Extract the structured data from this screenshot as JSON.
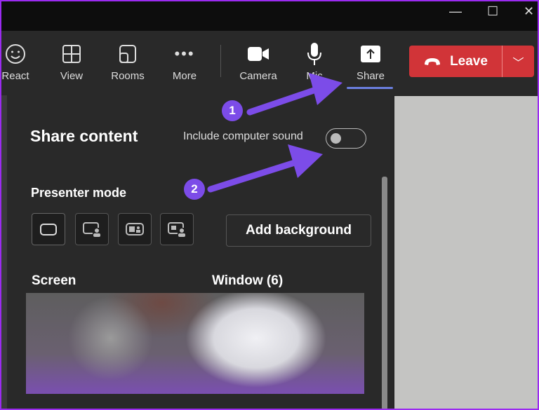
{
  "window_controls": {
    "minimize": "—",
    "maximize": "☐",
    "close": "✕"
  },
  "toolbar": {
    "react": "React",
    "view": "View",
    "rooms": "Rooms",
    "more": "More",
    "camera": "Camera",
    "mic": "Mic",
    "share": "Share",
    "leave": "Leave"
  },
  "share_panel": {
    "title": "Share content",
    "include_sound_label": "Include computer sound",
    "include_sound_on": false,
    "presenter_mode_label": "Presenter mode",
    "add_background": "Add background",
    "screen_label": "Screen",
    "window_label": "Window (6)"
  },
  "annotations": {
    "step1": "1",
    "step2": "2",
    "color": "#7c4ce8"
  },
  "colors": {
    "leave": "#d13438",
    "accent": "#6b7fe0"
  }
}
